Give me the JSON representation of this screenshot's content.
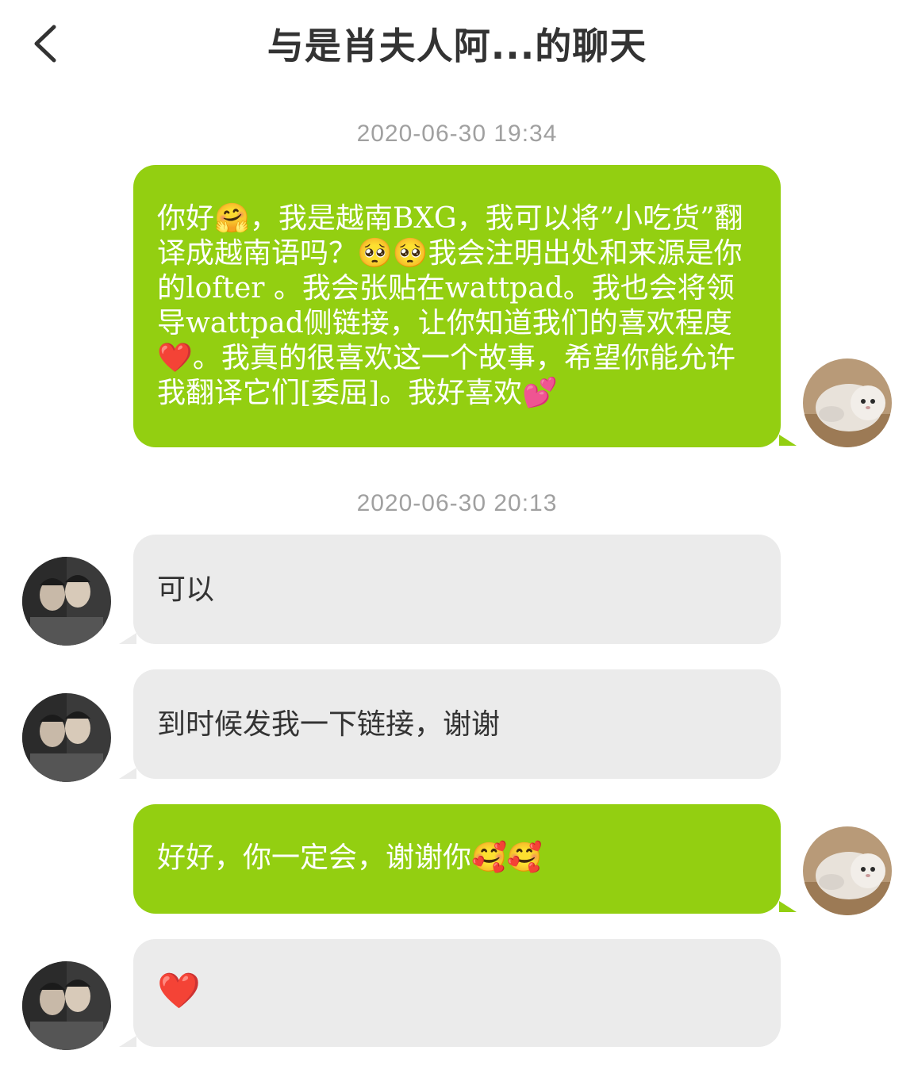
{
  "header": {
    "title": "与是肖夫人阿...的聊天"
  },
  "conversation": {
    "timestamps": [
      "2020-06-30 19:34",
      "2020-06-30 20:13"
    ],
    "messages": [
      {
        "direction": "outgoing",
        "text": "你好🤗，我是越南BXG，我可以将”小吃货”翻译成越南语吗？🥺🥺我会注明出处和来源是你的lofter 。我会张贴在wattpad。我也会将领导wattpad侧链接，让你知道我们的喜欢程度❤️。我真的很喜欢这一个故事，希望你能允许我翻译它们[委屈]。我好喜欢💕"
      },
      {
        "direction": "incoming",
        "text": "可以"
      },
      {
        "direction": "incoming",
        "text": "到时候发我一下链接，谢谢"
      },
      {
        "direction": "outgoing",
        "text": "好好，你一定会，谢谢你🥰🥰"
      },
      {
        "direction": "incoming",
        "text": "❤️"
      }
    ]
  },
  "colors": {
    "outgoing_bubble": "#93cf11",
    "incoming_bubble": "#ebebeb",
    "timestamp": "#a0a0a0",
    "title": "#333333"
  },
  "icons": {
    "back": "chevron-left-icon",
    "self_avatar": "cat-avatar",
    "peer_avatar": "couple-photo-avatar"
  }
}
